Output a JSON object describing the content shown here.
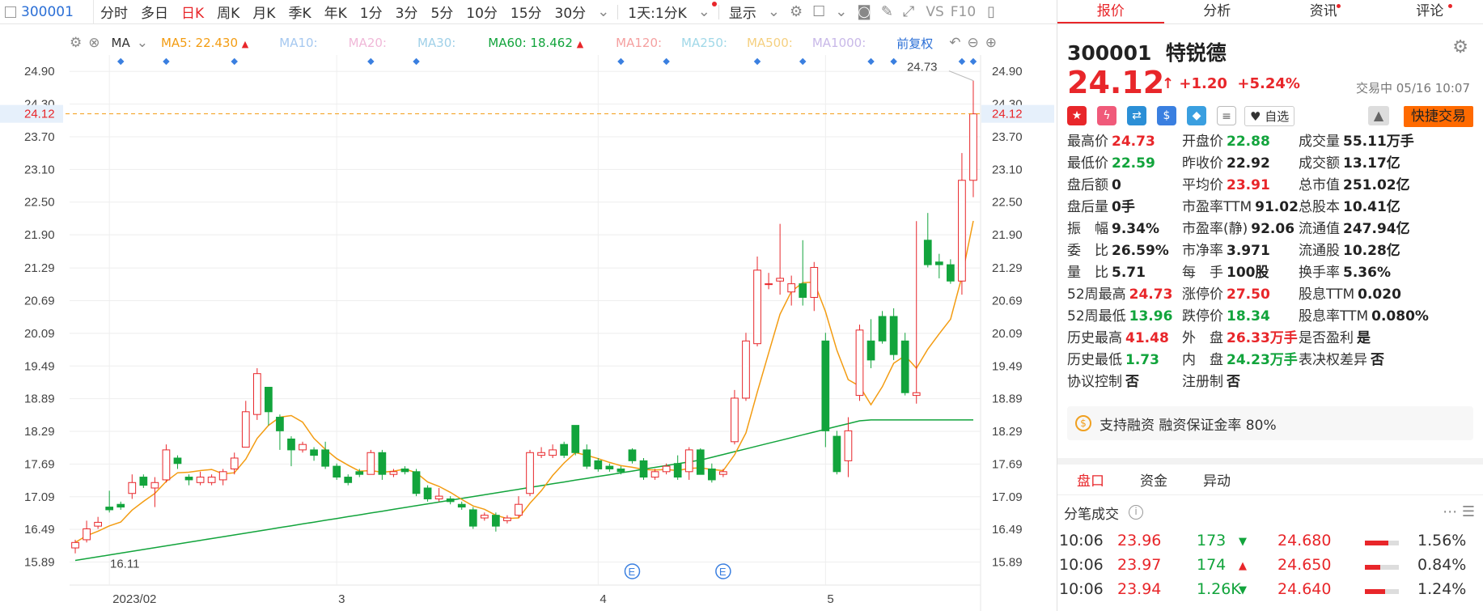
{
  "toolbar": {
    "code": "300001",
    "periods": [
      "分时",
      "多日",
      "日K",
      "周K",
      "月K",
      "季K",
      "年K",
      "1分",
      "3分",
      "5分",
      "10分",
      "15分",
      "30分"
    ],
    "active_period": "日K",
    "range": "1天:1分K",
    "display": "显示",
    "vs": "VS",
    "f10": "F10"
  },
  "ma_bar": {
    "label": "MA",
    "ma5": "MA5: 22.430",
    "ma10": "MA10:",
    "ma20": "MA20:",
    "ma30": "MA30:",
    "ma60": "MA60: 18.462",
    "ma120": "MA120:",
    "ma250": "MA250:",
    "ma500": "MA500:",
    "ma1000": "MA1000:",
    "adjust": "前复权",
    "colors": {
      "ma5": "#f39c12",
      "ma10": "#a5c8f0",
      "ma20": "#f0b8d8",
      "ma30": "#9fd0e8",
      "ma60": "#12a43c",
      "ma120": "#f5a0a0",
      "ma250": "#a0d8e8",
      "ma500": "#f5d080",
      "ma1000": "#c8b8e8"
    }
  },
  "chart_data": {
    "type": "candlestick",
    "y_ticks": [
      "24.90",
      "24.30",
      "23.70",
      "23.10",
      "22.50",
      "21.90",
      "21.29",
      "20.69",
      "20.09",
      "19.49",
      "18.89",
      "18.29",
      "17.69",
      "17.09",
      "16.49",
      "15.89"
    ],
    "ylim": [
      15.69,
      25.2
    ],
    "x_labels": [
      {
        "label": "2023/02",
        "index": 3
      },
      {
        "label": "3",
        "index": 23
      },
      {
        "label": "4",
        "index": 46
      },
      {
        "label": "5",
        "index": 66
      }
    ],
    "current_price": "24.12",
    "high_label": "24.73",
    "low_label": "16.11",
    "event_marker": "E",
    "event_indices": [
      49,
      57
    ],
    "candles": [
      [
        16.15,
        16.25,
        16.05,
        16.3
      ],
      [
        16.3,
        16.5,
        16.25,
        16.65
      ],
      [
        16.55,
        16.62,
        16.5,
        16.72
      ],
      [
        16.9,
        16.85,
        16.8,
        17.2
      ],
      [
        16.95,
        16.9,
        16.85,
        17.0
      ],
      [
        17.15,
        17.35,
        17.05,
        17.5
      ],
      [
        17.45,
        17.3,
        17.25,
        17.5
      ],
      [
        17.25,
        17.35,
        16.9,
        17.45
      ],
      [
        17.4,
        17.95,
        17.35,
        18.05
      ],
      [
        17.8,
        17.7,
        17.6,
        17.85
      ],
      [
        17.45,
        17.4,
        17.3,
        17.5
      ],
      [
        17.35,
        17.45,
        17.3,
        17.55
      ],
      [
        17.35,
        17.45,
        17.3,
        17.5
      ],
      [
        17.4,
        17.55,
        17.3,
        17.6
      ],
      [
        17.6,
        17.8,
        17.5,
        17.9
      ],
      [
        18.0,
        18.65,
        18.0,
        18.85
      ],
      [
        18.6,
        19.35,
        18.5,
        19.45
      ],
      [
        19.1,
        18.65,
        18.4,
        19.1
      ],
      [
        18.55,
        18.3,
        17.95,
        18.6
      ],
      [
        18.15,
        17.95,
        17.65,
        18.2
      ],
      [
        17.95,
        18.05,
        17.9,
        18.1
      ],
      [
        17.95,
        17.85,
        17.75,
        18.0
      ],
      [
        17.95,
        17.65,
        17.6,
        18.1
      ],
      [
        17.65,
        17.45,
        17.4,
        17.7
      ],
      [
        17.45,
        17.35,
        17.3,
        17.5
      ],
      [
        17.55,
        17.5,
        17.45,
        17.6
      ],
      [
        17.5,
        17.9,
        17.5,
        17.95
      ],
      [
        17.9,
        17.5,
        17.4,
        17.95
      ],
      [
        17.5,
        17.55,
        17.45,
        17.6
      ],
      [
        17.6,
        17.55,
        17.5,
        17.65
      ],
      [
        17.55,
        17.15,
        17.1,
        17.6
      ],
      [
        17.25,
        17.05,
        17.0,
        17.3
      ],
      [
        17.05,
        17.1,
        17.0,
        17.25
      ],
      [
        17.05,
        17.0,
        16.95,
        17.1
      ],
      [
        16.95,
        16.9,
        16.85,
        17.0
      ],
      [
        16.85,
        16.55,
        16.5,
        16.9
      ],
      [
        16.7,
        16.75,
        16.65,
        16.8
      ],
      [
        16.75,
        16.55,
        16.45,
        16.8
      ],
      [
        16.65,
        16.7,
        16.6,
        16.75
      ],
      [
        16.75,
        16.95,
        16.7,
        17.1
      ],
      [
        17.15,
        17.9,
        17.1,
        17.95
      ],
      [
        17.85,
        17.9,
        17.8,
        18.0
      ],
      [
        17.85,
        17.95,
        17.8,
        18.05
      ],
      [
        18.05,
        17.85,
        17.8,
        18.1
      ],
      [
        18.4,
        17.9,
        17.85,
        18.4
      ],
      [
        17.95,
        17.65,
        17.6,
        18.05
      ],
      [
        17.75,
        17.6,
        17.55,
        17.8
      ],
      [
        17.65,
        17.6,
        17.55,
        17.7
      ],
      [
        17.6,
        17.55,
        17.5,
        17.65
      ],
      [
        17.95,
        17.75,
        17.7,
        17.98
      ],
      [
        17.75,
        17.45,
        17.4,
        17.8
      ],
      [
        17.45,
        17.55,
        17.4,
        17.6
      ],
      [
        17.55,
        17.65,
        17.5,
        17.7
      ],
      [
        17.7,
        17.45,
        17.4,
        17.85
      ],
      [
        17.55,
        17.95,
        17.4,
        18.0
      ],
      [
        17.95,
        17.5,
        17.5,
        17.98
      ],
      [
        17.6,
        17.4,
        17.35,
        17.7
      ],
      [
        17.5,
        17.55,
        17.45,
        17.6
      ],
      [
        18.1,
        18.9,
        18.05,
        19.05
      ],
      [
        18.9,
        19.95,
        18.85,
        20.1
      ],
      [
        19.9,
        21.25,
        19.85,
        21.5
      ],
      [
        21.0,
        21.0,
        20.9,
        21.2
      ],
      [
        21.05,
        21.1,
        20.8,
        22.1
      ],
      [
        20.85,
        21.0,
        20.6,
        21.15
      ],
      [
        21.0,
        20.75,
        20.6,
        21.8
      ],
      [
        20.75,
        21.3,
        20.5,
        21.4
      ],
      [
        19.95,
        18.3,
        18.0,
        20.1
      ],
      [
        18.2,
        17.55,
        17.5,
        18.3
      ],
      [
        17.75,
        18.3,
        17.45,
        18.55
      ],
      [
        18.95,
        20.15,
        18.85,
        20.25
      ],
      [
        19.95,
        19.6,
        19.45,
        20.35
      ],
      [
        20.4,
        19.95,
        19.9,
        20.5
      ],
      [
        20.4,
        19.7,
        19.6,
        20.55
      ],
      [
        19.95,
        19.0,
        18.95,
        20.1
      ],
      [
        18.95,
        19.0,
        18.8,
        22.15
      ],
      [
        21.8,
        21.35,
        21.3,
        22.3
      ],
      [
        21.4,
        21.35,
        21.1,
        21.55
      ],
      [
        21.35,
        21.05,
        21.0,
        21.45
      ],
      [
        21.05,
        22.9,
        20.8,
        23.4
      ],
      [
        22.9,
        24.12,
        22.59,
        24.73
      ]
    ]
  },
  "quote": {
    "code": "300001",
    "name": "特锐德",
    "price": "24.12",
    "arrow": "↑",
    "change": "+1.20",
    "change_pct": "+5.24%",
    "status": "交易中 05/16 10:07",
    "watch": "自选",
    "fast_trade": "快捷交易",
    "fields": [
      {
        "label": "最高价",
        "value": "24.73",
        "color": "r"
      },
      {
        "label": "最低价",
        "value": "22.59",
        "color": "g"
      },
      {
        "label": "盘后额",
        "value": "0",
        "color": "k"
      },
      {
        "label": "盘后量",
        "value": "0手",
        "color": "k"
      },
      {
        "label": "振　幅",
        "value": "9.34%",
        "color": "k"
      },
      {
        "label": "委　比",
        "value": "26.59%",
        "color": "k"
      },
      {
        "label": "量　比",
        "value": "5.71",
        "color": "k"
      },
      {
        "label": "52周最高",
        "value": "24.73",
        "color": "r"
      },
      {
        "label": "52周最低",
        "value": "13.96",
        "color": "g"
      },
      {
        "label": "历史最高",
        "value": "41.48",
        "color": "r"
      },
      {
        "label": "历史最低",
        "value": "1.73",
        "color": "g"
      },
      {
        "label": "协议控制",
        "value": "否",
        "color": "k"
      },
      {
        "label": "开盘价",
        "value": "22.88",
        "color": "g"
      },
      {
        "label": "昨收价",
        "value": "22.92",
        "color": "k"
      },
      {
        "label": "平均价",
        "value": "23.91",
        "color": "r"
      },
      {
        "label": "市盈率TTM",
        "value": "91.02",
        "color": "k"
      },
      {
        "label": "市盈率(静)",
        "value": "92.06",
        "color": "k"
      },
      {
        "label": "市净率",
        "value": "3.971",
        "color": "k"
      },
      {
        "label": "每　手",
        "value": "100股",
        "color": "k"
      },
      {
        "label": "涨停价",
        "value": "27.50",
        "color": "r"
      },
      {
        "label": "跌停价",
        "value": "18.34",
        "color": "g"
      },
      {
        "label": "外　盘",
        "value": "26.33万手",
        "color": "r"
      },
      {
        "label": "内　盘",
        "value": "24.23万手",
        "color": "g"
      },
      {
        "label": "注册制",
        "value": "否",
        "color": "k"
      },
      {
        "label": "成交量",
        "value": "55.11万手",
        "color": "k"
      },
      {
        "label": "成交额",
        "value": "13.17亿",
        "color": "k"
      },
      {
        "label": "总市值",
        "value": "251.02亿",
        "color": "k"
      },
      {
        "label": "总股本",
        "value": "10.41亿",
        "color": "k"
      },
      {
        "label": "流通值",
        "value": "247.94亿",
        "color": "k"
      },
      {
        "label": "流通股",
        "value": "10.28亿",
        "color": "k"
      },
      {
        "label": "换手率",
        "value": "5.36%",
        "color": "k"
      },
      {
        "label": "股息TTM",
        "value": "0.020",
        "color": "k"
      },
      {
        "label": "股息率TTM",
        "value": "0.080%",
        "color": "k"
      },
      {
        "label": "是否盈利",
        "value": "是",
        "color": "k"
      },
      {
        "label": "表决权差异",
        "value": "否",
        "color": "k"
      }
    ],
    "margin_text": "支持融资 融资保证金率 80%"
  },
  "right_tabs": [
    "报价",
    "分析",
    "资讯",
    "评论"
  ],
  "sub_tabs": [
    "盘口",
    "资金",
    "异动"
  ],
  "ticks_title": "分笔成交",
  "ticks": [
    {
      "time": "10:06",
      "price": "23.96",
      "vol": "173",
      "dir": "▼",
      "ref": "24.680",
      "pct": "1.56%",
      "fill": 0.7
    },
    {
      "time": "10:06",
      "price": "23.97",
      "vol": "174",
      "dir": "▲",
      "ref": "24.650",
      "pct": "0.84%",
      "fill": 0.45
    },
    {
      "time": "10:06",
      "price": "23.94",
      "vol": "1.26K",
      "dir": "▼",
      "ref": "24.640",
      "pct": "1.24%",
      "fill": 0.6
    }
  ]
}
